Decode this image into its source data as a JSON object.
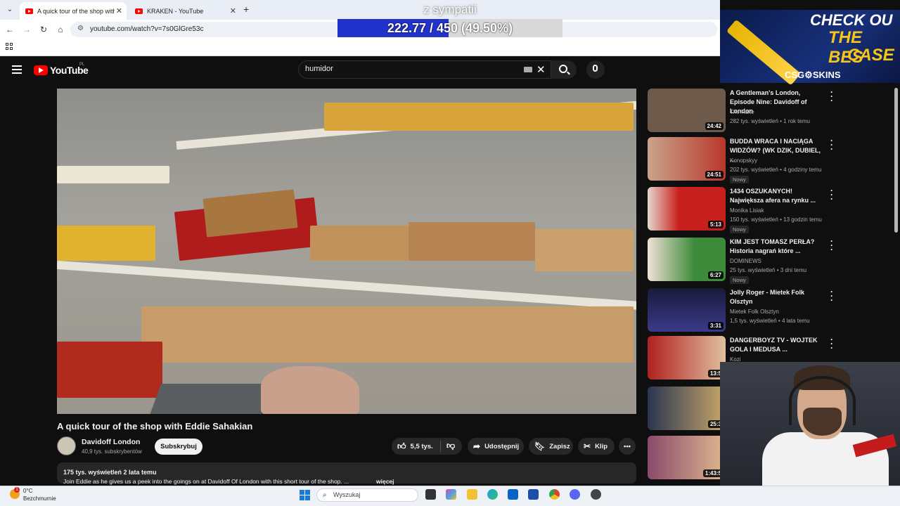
{
  "browser": {
    "tabs": [
      {
        "title": "A quick tour of the shop with E",
        "active": true
      },
      {
        "title": "KRAKEN - YouTube",
        "active": false
      }
    ],
    "url": "youtube.com/watch?v=7s0GlGre53c"
  },
  "donation": {
    "label": "z sympatii",
    "progress_text": "222.77 / 450 (49.50%)",
    "fraction": 0.495
  },
  "youtube": {
    "region": "PL",
    "logo_text": "YouTube",
    "search_value": "humidor"
  },
  "video": {
    "title": "A quick tour of the shop with Eddie Sahakian",
    "channel": "Davidoff London",
    "subscribers": "40,9 tys. subskrybentów",
    "subscribe_label": "Subskrybuj",
    "likes": "5,5 tys.",
    "share_label": "Udostępnij",
    "save_label": "Zapisz",
    "clip_label": "Klip",
    "meta": "175 tys. wyświetleń  2 lata temu",
    "description": "Join Eddie as he gives us a peek into the goings on at Davidoff Of London with this short tour of the shop. ...",
    "more_label": "więcej"
  },
  "recommendations": [
    {
      "title": "A Gentleman's London, Episode Nine: Davidoff of London",
      "channel": "The Rake",
      "meta": "282 tys. wyświetleń • 1 rok temu",
      "duration": "24:42",
      "new": "",
      "thumb_color": "#6d5a4a"
    },
    {
      "title": "BUDDA WRACA I NACIĄGA WIDZÓW? (WK DZIK, DUBIEL, ...",
      "channel": "Konopskyy",
      "meta": "202 tys. wyświetleń • 4 godziny temu",
      "duration": "24:51",
      "new": "Nowy",
      "thumb_color": "#b8372c"
    },
    {
      "title": "1434 OSZUKANYCH! Największa afera na rynku ...",
      "channel": "Monika Lisiak",
      "meta": "150 tys. wyświetleń • 13 godzin temu",
      "duration": "5:13",
      "new": "Nowy",
      "thumb_color": "#c8201c"
    },
    {
      "title": "KIM JEST TOMASZ PERŁA? Historia nagrań które ...",
      "channel": "DOMINEWS",
      "meta": "25 tys. wyświetleń • 3 dni temu",
      "duration": "6:27",
      "new": "Nowy",
      "thumb_color": "#3d8a3a"
    },
    {
      "title": "Jolly Roger - Mietek Folk Olsztyn",
      "channel": "Mietek Folk Olsztyn",
      "meta": "1,5 tys. wyświetleń • 4 lata temu",
      "duration": "3:31",
      "new": "",
      "thumb_color": "#3a3a8a"
    },
    {
      "title": "DANGERBOYZ TV - WOJTEK GOLA I MEDUSA ...",
      "channel": "Kozi",
      "meta": "",
      "duration": "13:5",
      "new": "",
      "thumb_color": "#b02020"
    },
    {
      "title": "",
      "channel": "",
      "meta": "",
      "duration": "25:3",
      "new": "",
      "thumb_color": "#2a3550"
    },
    {
      "title": "",
      "channel": "",
      "meta": "",
      "duration": "1:43:5",
      "new": "",
      "thumb_color": "#8a4a6a"
    }
  ],
  "ad": {
    "line1": "CHECK OU",
    "line2": "THE BES",
    "line3": "CASE",
    "brand": "CSG⚙SKINS"
  },
  "taskbar": {
    "temperature": "0°C",
    "weather": "Bezchmurnie",
    "weather_badge": "1",
    "search_label": "Wyszukaj"
  }
}
